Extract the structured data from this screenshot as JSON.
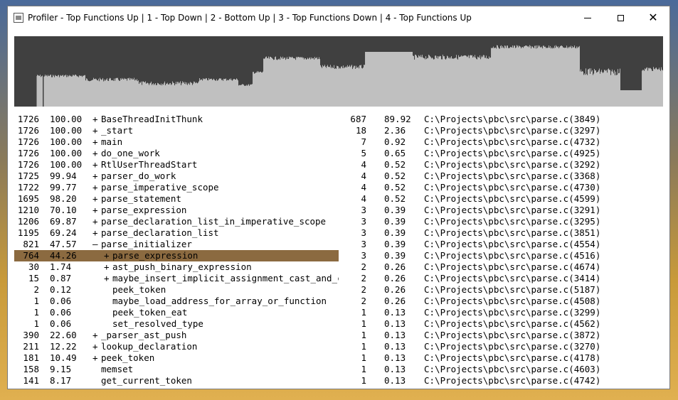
{
  "window": {
    "title": "Profiler - Top Functions Up | 1 - Top Down | 2 - Bottom Up | 3 - Top Functions Down | 4 - Top Functions Up",
    "controls": {
      "minimize": "minimize",
      "maximize": "maximize",
      "close": "✕"
    }
  },
  "colors": {
    "timeline_bg": "#c0c0c0",
    "timeline_bar": "#404040",
    "selection": "#8b6a40"
  },
  "tree": [
    {
      "count": "1726",
      "pct": "100.00",
      "indent": 0,
      "expander": "+",
      "name": "BaseThreadInitThunk"
    },
    {
      "count": "1726",
      "pct": "100.00",
      "indent": 0,
      "expander": "+",
      "name": "_start"
    },
    {
      "count": "1726",
      "pct": "100.00",
      "indent": 0,
      "expander": "+",
      "name": "main"
    },
    {
      "count": "1726",
      "pct": "100.00",
      "indent": 0,
      "expander": "+",
      "name": "do_one_work"
    },
    {
      "count": "1726",
      "pct": "100.00",
      "indent": 0,
      "expander": "+",
      "name": "RtlUserThreadStart"
    },
    {
      "count": "1725",
      "pct": "99.94",
      "indent": 0,
      "expander": "+",
      "name": "parser_do_work"
    },
    {
      "count": "1722",
      "pct": "99.77",
      "indent": 0,
      "expander": "+",
      "name": "parse_imperative_scope"
    },
    {
      "count": "1695",
      "pct": "98.20",
      "indent": 0,
      "expander": "+",
      "name": "parse_statement"
    },
    {
      "count": "1210",
      "pct": "70.10",
      "indent": 0,
      "expander": "+",
      "name": "parse_expression"
    },
    {
      "count": "1206",
      "pct": "69.87",
      "indent": 0,
      "expander": "+",
      "name": "parse_declaration_list_in_imperative_scope"
    },
    {
      "count": "1195",
      "pct": "69.24",
      "indent": 0,
      "expander": "+",
      "name": "parse_declaration_list"
    },
    {
      "count": "821",
      "pct": "47.57",
      "indent": 0,
      "expander": "–",
      "name": "parse_initializer"
    },
    {
      "count": "764",
      "pct": "44.26",
      "indent": 1,
      "expander": "+",
      "name": "parse_expression",
      "selected": true
    },
    {
      "count": "30",
      "pct": "1.74",
      "indent": 1,
      "expander": "+",
      "name": "ast_push_binary_expression"
    },
    {
      "count": "15",
      "pct": "0.87",
      "indent": 1,
      "expander": "+",
      "name": "maybe_insert_implicit_assignment_cast_and_ch"
    },
    {
      "count": "2",
      "pct": "0.12",
      "indent": 1,
      "expander": "",
      "name": "peek_token"
    },
    {
      "count": "1",
      "pct": "0.06",
      "indent": 1,
      "expander": "",
      "name": "maybe_load_address_for_array_or_function"
    },
    {
      "count": "1",
      "pct": "0.06",
      "indent": 1,
      "expander": "",
      "name": "peek_token_eat"
    },
    {
      "count": "1",
      "pct": "0.06",
      "indent": 1,
      "expander": "",
      "name": "set_resolved_type"
    },
    {
      "count": "390",
      "pct": "22.60",
      "indent": 0,
      "expander": "+",
      "name": "_parser_ast_push"
    },
    {
      "count": "211",
      "pct": "12.22",
      "indent": 0,
      "expander": "+",
      "name": "lookup_declaration"
    },
    {
      "count": "181",
      "pct": "10.49",
      "indent": 0,
      "expander": "+",
      "name": "peek_token"
    },
    {
      "count": "158",
      "pct": "9.15",
      "indent": 0,
      "expander": "",
      "name": "memset"
    },
    {
      "count": "141",
      "pct": "8.17",
      "indent": 0,
      "expander": "",
      "name": "get_current_token"
    }
  ],
  "sources": [
    {
      "count": "687",
      "pct": "89.92",
      "file": "C:\\Projects\\pbc\\src\\parse.c(3849)"
    },
    {
      "count": "18",
      "pct": "2.36",
      "file": "C:\\Projects\\pbc\\src\\parse.c(3297)"
    },
    {
      "count": "7",
      "pct": "0.92",
      "file": "C:\\Projects\\pbc\\src\\parse.c(4732)"
    },
    {
      "count": "5",
      "pct": "0.65",
      "file": "C:\\Projects\\pbc\\src\\parse.c(4925)"
    },
    {
      "count": "4",
      "pct": "0.52",
      "file": "C:\\Projects\\pbc\\src\\parse.c(3292)"
    },
    {
      "count": "4",
      "pct": "0.52",
      "file": "C:\\Projects\\pbc\\src\\parse.c(3368)"
    },
    {
      "count": "4",
      "pct": "0.52",
      "file": "C:\\Projects\\pbc\\src\\parse.c(4730)"
    },
    {
      "count": "4",
      "pct": "0.52",
      "file": "C:\\Projects\\pbc\\src\\parse.c(4599)"
    },
    {
      "count": "3",
      "pct": "0.39",
      "file": "C:\\Projects\\pbc\\src\\parse.c(3291)"
    },
    {
      "count": "3",
      "pct": "0.39",
      "file": "C:\\Projects\\pbc\\src\\parse.c(3295)"
    },
    {
      "count": "3",
      "pct": "0.39",
      "file": "C:\\Projects\\pbc\\src\\parse.c(3851)"
    },
    {
      "count": "3",
      "pct": "0.39",
      "file": "C:\\Projects\\pbc\\src\\parse.c(4554)"
    },
    {
      "count": "3",
      "pct": "0.39",
      "file": "C:\\Projects\\pbc\\src\\parse.c(4516)"
    },
    {
      "count": "2",
      "pct": "0.26",
      "file": "C:\\Projects\\pbc\\src\\parse.c(4674)"
    },
    {
      "count": "2",
      "pct": "0.26",
      "file": "C:\\Projects\\pbc\\src\\parse.c(3414)"
    },
    {
      "count": "2",
      "pct": "0.26",
      "file": "C:\\Projects\\pbc\\src\\parse.c(5187)"
    },
    {
      "count": "2",
      "pct": "0.26",
      "file": "C:\\Projects\\pbc\\src\\parse.c(4508)"
    },
    {
      "count": "1",
      "pct": "0.13",
      "file": "C:\\Projects\\pbc\\src\\parse.c(3299)"
    },
    {
      "count": "1",
      "pct": "0.13",
      "file": "C:\\Projects\\pbc\\src\\parse.c(4562)"
    },
    {
      "count": "1",
      "pct": "0.13",
      "file": "C:\\Projects\\pbc\\src\\parse.c(3872)"
    },
    {
      "count": "1",
      "pct": "0.13",
      "file": "C:\\Projects\\pbc\\src\\parse.c(3270)"
    },
    {
      "count": "1",
      "pct": "0.13",
      "file": "C:\\Projects\\pbc\\src\\parse.c(4178)"
    },
    {
      "count": "1",
      "pct": "0.13",
      "file": "C:\\Projects\\pbc\\src\\parse.c(4603)"
    },
    {
      "count": "1",
      "pct": "0.13",
      "file": "C:\\Projects\\pbc\\src\\parse.c(4742)"
    }
  ]
}
